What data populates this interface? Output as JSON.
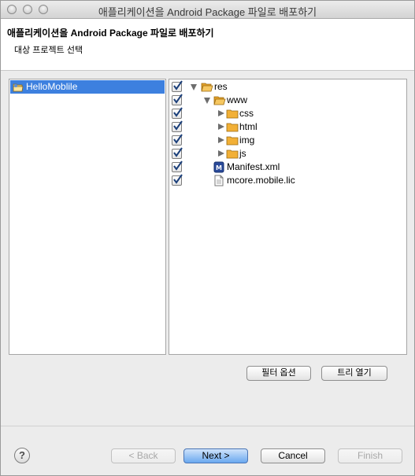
{
  "window": {
    "title": "애플리케이션을 Android Package 파일로 배포하기"
  },
  "header": {
    "title": "애플리케이션을 Android Package 파일로 배포하기",
    "subtitle": "대상 프로젝트 선택"
  },
  "projects": [
    {
      "label": "HelloMoblile",
      "selected": true,
      "icon": "project-folder-icon"
    }
  ],
  "tree": [
    {
      "label": "res",
      "checked": true,
      "expanded": true,
      "type": "folder",
      "icon": "folder-open-icon"
    },
    {
      "label": "www",
      "checked": true,
      "expanded": true,
      "type": "folder",
      "icon": "folder-open-icon"
    },
    {
      "label": "css",
      "checked": true,
      "expanded": false,
      "type": "folder",
      "icon": "folder-icon"
    },
    {
      "label": "html",
      "checked": true,
      "expanded": false,
      "type": "folder",
      "icon": "folder-icon"
    },
    {
      "label": "img",
      "checked": true,
      "expanded": false,
      "type": "folder",
      "icon": "folder-icon"
    },
    {
      "label": "js",
      "checked": true,
      "expanded": false,
      "type": "folder",
      "icon": "folder-icon"
    },
    {
      "label": "Manifest.xml",
      "checked": true,
      "type": "file",
      "icon": "manifest-file-icon"
    },
    {
      "label": "mcore.mobile.lic",
      "checked": true,
      "type": "file",
      "icon": "text-file-icon"
    }
  ],
  "buttons": {
    "filter_options": "필터 옵션",
    "expand_tree": "트리 열기",
    "back": "< Back",
    "next": "Next >",
    "cancel": "Cancel",
    "finish": "Finish",
    "help": "?"
  },
  "colors": {
    "selection": "#3d80df",
    "folder": "#f2b036",
    "primary_button": "#6aa8ef"
  }
}
